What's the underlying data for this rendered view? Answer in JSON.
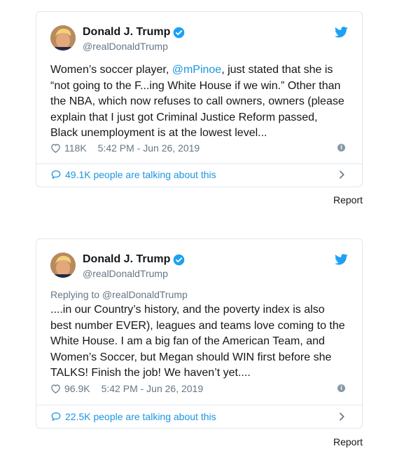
{
  "tweets": [
    {
      "author_name": "Donald J. Trump",
      "author_handle": "@realDonaldTrump",
      "reply_to": "",
      "text_lines": [
        [
          "Women’s soccer player, ",
          "@mPinoe",
          ", just stated that she is"
        ],
        [
          "“not going to the F...ing White House if we win.” Other than"
        ],
        [
          "the NBA, which now refuses to call owners, owners (please"
        ],
        [
          "explain that I just got Criminal Justice Reform passed,"
        ],
        [
          "Black unemployment is at the lowest level..."
        ]
      ],
      "likes": "118K",
      "timestamp": "5:42 PM - Jun 26, 2019",
      "talking": "49.1K people are talking about this",
      "report": "Report"
    },
    {
      "author_name": "Donald J. Trump",
      "author_handle": "@realDonaldTrump",
      "reply_to": "Replying to @realDonaldTrump",
      "text_lines": [
        [
          "....in our Country’s history, and the poverty index is also"
        ],
        [
          "best number EVER), leagues and teams love coming to the"
        ],
        [
          "White House. I am a big fan of the American Team, and"
        ],
        [
          "Women’s Soccer, but Megan should WIN first before she"
        ],
        [
          "TALKS! Finish the job! We haven’t yet...."
        ]
      ],
      "likes": "96.9K",
      "timestamp": "5:42 PM - Jun 26, 2019",
      "talking": "22.5K people are talking about this",
      "report": "Report"
    }
  ],
  "colors": {
    "link": "#1b95e0",
    "secondary": "#657786",
    "border": "#e1e8ed"
  },
  "icons": {
    "verified": "verified-badge-icon",
    "brand": "twitter-bird-icon",
    "like": "heart-icon",
    "info": "info-icon",
    "talk": "speech-bubble-icon",
    "more": "chevron-right-icon"
  }
}
